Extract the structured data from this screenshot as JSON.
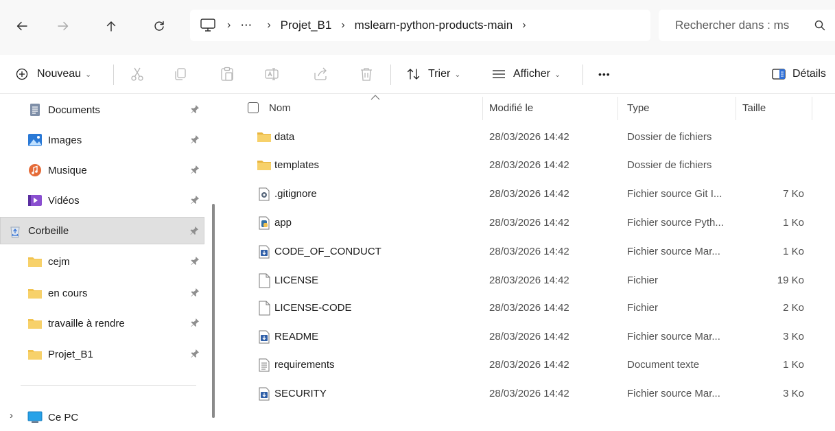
{
  "address_bar": {
    "breadcrumbs": [
      "Projet_B1",
      "mslearn-python-products-main"
    ],
    "overflow": "⋯",
    "search_placeholder": "Rechercher dans : ms"
  },
  "toolbar": {
    "new_label": "Nouveau",
    "sort_label": "Trier",
    "view_label": "Afficher",
    "more_label": "•••",
    "details_label": "Détails"
  },
  "sidebar": {
    "items": [
      {
        "label": "Documents",
        "icon": "documents-icon"
      },
      {
        "label": "Images",
        "icon": "images-icon"
      },
      {
        "label": "Musique",
        "icon": "music-icon"
      },
      {
        "label": "Vidéos",
        "icon": "videos-icon"
      },
      {
        "label": "Corbeille",
        "icon": "recycle-bin-icon"
      },
      {
        "label": "cejm",
        "icon": "folder-icon"
      },
      {
        "label": "en cours",
        "icon": "folder-icon"
      },
      {
        "label": "travaille à rendre",
        "icon": "folder-icon"
      },
      {
        "label": "Projet_B1",
        "icon": "folder-icon"
      }
    ],
    "this_pc": "Ce PC",
    "selected": "Corbeille"
  },
  "file_list": {
    "columns": [
      "Nom",
      "Modifié le",
      "Type",
      "Taille"
    ],
    "rows": [
      {
        "name": "data",
        "date": "28/03/2026 14:42",
        "type": "Dossier de fichiers",
        "size": "",
        "icon": "folder-icon"
      },
      {
        "name": "templates",
        "date": "28/03/2026 14:42",
        "type": "Dossier de fichiers",
        "size": "",
        "icon": "folder-icon"
      },
      {
        "name": ".gitignore",
        "date": "28/03/2026 14:42",
        "type": "Fichier source Git I...",
        "size": "7 Ko",
        "icon": "gear-file-icon"
      },
      {
        "name": "app",
        "date": "28/03/2026 14:42",
        "type": "Fichier source Pyth...",
        "size": "1 Ko",
        "icon": "python-file-icon"
      },
      {
        "name": "CODE_OF_CONDUCT",
        "date": "28/03/2026 14:42",
        "type": "Fichier source Mar...",
        "size": "1 Ko",
        "icon": "markdown-file-icon"
      },
      {
        "name": "LICENSE",
        "date": "28/03/2026 14:42",
        "type": "Fichier",
        "size": "19 Ko",
        "icon": "blank-file-icon"
      },
      {
        "name": "LICENSE-CODE",
        "date": "28/03/2026 14:42",
        "type": "Fichier",
        "size": "2 Ko",
        "icon": "blank-file-icon"
      },
      {
        "name": "README",
        "date": "28/03/2026 14:42",
        "type": "Fichier source Mar...",
        "size": "3 Ko",
        "icon": "markdown-file-icon"
      },
      {
        "name": "requirements",
        "date": "28/03/2026 14:42",
        "type": "Document texte",
        "size": "1 Ko",
        "icon": "text-file-icon"
      },
      {
        "name": "SECURITY",
        "date": "28/03/2026 14:42",
        "type": "Fichier source Mar...",
        "size": "3 Ko",
        "icon": "markdown-file-icon"
      }
    ]
  },
  "colors": {
    "folder": "#f2c34f",
    "accent_blue": "#2f6fd6",
    "selection": "#e0e0e0"
  }
}
